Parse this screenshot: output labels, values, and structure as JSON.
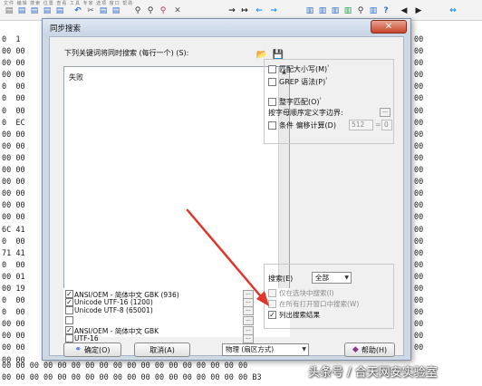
{
  "app": {
    "menu_faint": "文件  编辑  搜索  位置  查看  工具  专家  选项  窗口  帮助",
    "toolbar_icons": [
      {
        "name": "new-file-icon",
        "glyph": "▤",
        "color": "#6d6d6d"
      },
      {
        "name": "open-icon",
        "glyph": "▤",
        "color": "#2c6fd1"
      },
      {
        "name": "save-icon",
        "glyph": "▤",
        "color": "#2c6fd1"
      },
      {
        "name": "print-icon",
        "glyph": "▤",
        "color": "#2c6fd1"
      },
      {
        "name": "properties-icon",
        "glyph": "▤",
        "color": "#2c6fd1"
      },
      {
        "name": "undo-icon",
        "glyph": "↶",
        "color": "#2c6fd1"
      },
      {
        "name": "cut-icon",
        "glyph": "✂",
        "color": "#555555"
      },
      {
        "name": "copy-icon",
        "glyph": "▤",
        "color": "#2c6fd1"
      },
      {
        "name": "paste-icon",
        "glyph": "▤",
        "color": "#2c6fd1"
      },
      {
        "name": "find-icon",
        "glyph": "⚲",
        "color": "#333333"
      },
      {
        "name": "find-hex-icon",
        "glyph": "⚲",
        "color": "#333333"
      },
      {
        "name": "replace-icon",
        "glyph": "⚲",
        "color": "#b03060"
      },
      {
        "name": "hex-icon",
        "glyph": "✕",
        "color": "#555555"
      },
      {
        "name": "goto-icon",
        "glyph": "→",
        "color": "#222222"
      },
      {
        "name": "goto-offset-icon",
        "glyph": "↦",
        "color": "#222222"
      },
      {
        "name": "back-icon",
        "glyph": "←",
        "color": "#1e90ff"
      },
      {
        "name": "forward-icon",
        "glyph": "→",
        "color": "#1e90ff"
      },
      {
        "name": "disk-icon",
        "glyph": "▥",
        "color": "#2c6fd1"
      },
      {
        "name": "ram-icon",
        "glyph": "▥",
        "color": "#2c6fd1"
      },
      {
        "name": "compare-icon",
        "glyph": "▥",
        "color": "#2c6fd1"
      },
      {
        "name": "tools-icon",
        "glyph": "▥",
        "color": "#1fa24a"
      },
      {
        "name": "search-icon",
        "glyph": "⚲",
        "color": "#333333"
      },
      {
        "name": "settings-icon",
        "glyph": "▥",
        "color": "#2c6fd1"
      },
      {
        "name": "help-icon",
        "glyph": "?",
        "color": "#2c6fd1"
      },
      {
        "name": "prev-icon",
        "glyph": "◀",
        "color": "#222222"
      },
      {
        "name": "next-icon",
        "glyph": "▶",
        "color": "#222222"
      },
      {
        "name": "nav-arrows-icon",
        "glyph": "↔",
        "color": "#1e90ff"
      }
    ],
    "hex_left_lines": [
      "0  1",
      "00 00",
      "00 00",
      "00 00",
      "0  00",
      "0  00",
      "0  00",
      "0  EC",
      "00 00",
      "00 00",
      "00 00",
      "00 00",
      "00 00",
      "00 00",
      "00 00",
      "00 00",
      "6C 41",
      "0  00",
      "71 41",
      "0  00",
      "00 01",
      "00 19",
      "0  00",
      "0  00",
      "00 00",
      "00 00",
      "00 00",
      "00 00"
    ],
    "hex_right_lines": [
      "00",
      "00",
      "00",
      "00",
      "00",
      "00",
      "00",
      "00",
      "00",
      "00",
      "00",
      "00",
      "00",
      "00",
      "00",
      "00",
      "00",
      "00",
      "00",
      "00",
      "00",
      "00",
      "00",
      "00",
      "00",
      "00",
      "00"
    ],
    "hex_bottom_lines": [
      "00 00 00 00 00 00 00 00 00 00 00 00 00 00 00 00 00 00",
      "00 00 00 00 00 00 00 00 00 00 00 00 00 00 00 00 00 00 B3"
    ],
    "watermark": "头条号 / 合天网安实验室"
  },
  "dialog": {
    "title": "同步搜索",
    "close_glyph": "✕",
    "search_label": "下列关键词将同时搜索 (每行一个) (S):",
    "terms_text": "失败",
    "open_icon": "📂",
    "save_icon": "💾",
    "options": {
      "match_case": "匹配大小写(M)",
      "match_case_sup": "³",
      "grep": "GREP 语法(P)",
      "grep_sup": "³",
      "whole_word": "整字匹配(O)",
      "whole_word_sup": "³",
      "boundary_label": "按字母顺序定义字边界:",
      "condition": "条件 偏移计算(D)",
      "offset_value": "512",
      "mod": "=",
      "mod_value": "0"
    },
    "encodings": [
      {
        "label": "ANSI/OEM - 简体中文 GBK (936)",
        "checked": true
      },
      {
        "label": "Unicode UTF-16  (1200)",
        "checked": true
      },
      {
        "label": "Unicode UTF-8 (65001)",
        "checked": false
      },
      {
        "label": "",
        "checked": false
      },
      {
        "label": "ANSI/OEM - 简体中文 GBK",
        "checked": true
      },
      {
        "label": "UTF-16",
        "checked": false
      }
    ],
    "search_scope": {
      "label": "搜索(E)",
      "value": "全部",
      "only_selection": "仅在选块中搜索(I)",
      "all_windows": "在所有打开窗口中搜索(W)",
      "list_results": "列出搜索结果",
      "list_results_checked": true
    },
    "buttons": {
      "ok": "确定(O)",
      "cancel": "取消(A)",
      "mode": "物理 (扇区方式)",
      "help": "帮助(H)"
    },
    "colors": {
      "annotation_arrow": "#e0352b",
      "dialog_frame": "#cfd9e6"
    }
  }
}
